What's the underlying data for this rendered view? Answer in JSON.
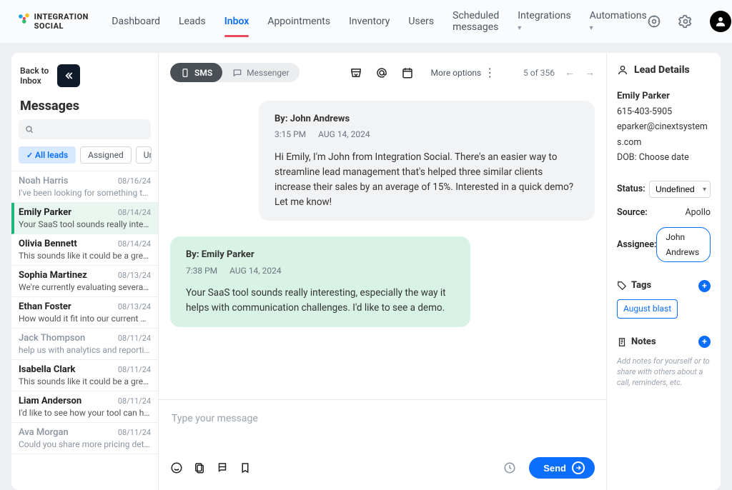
{
  "nav": {
    "brand": "INTEGRATION SOCIAL",
    "items": [
      "Dashboard",
      "Leads",
      "Inbox",
      "Appointments",
      "Inventory",
      "Users",
      "Scheduled messages",
      "Integrations",
      "Automations"
    ],
    "active_index": 2
  },
  "sidebar": {
    "back_label": "Back to Inbox",
    "title": "Messages",
    "filters": {
      "all": "All leads",
      "assigned": "Assigned",
      "unassigned": "Unassigned"
    },
    "leads": [
      {
        "name": "Noah Harris",
        "date": "08/16/24",
        "preview": "I've been looking for something th…",
        "dim": true,
        "selected": false
      },
      {
        "name": "Emily Parker",
        "date": "08/14/24",
        "preview": "Your SaaS tool sounds really inter…",
        "dim": false,
        "selected": true
      },
      {
        "name": "Olivia Bennett",
        "date": "08/14/24",
        "preview": "This sounds like it could be a great…",
        "dim": false,
        "selected": false
      },
      {
        "name": "Sophia Martinez",
        "date": "08/13/24",
        "preview": "We're currently evaluating several…",
        "dim": false,
        "selected": false
      },
      {
        "name": "Ethan Foster",
        "date": "08/13/24",
        "preview": "How would it fit into our current pr…",
        "dim": false,
        "selected": false
      },
      {
        "name": "Jack Thompson",
        "date": "08/11/24",
        "preview": "help us with analytics and reporti…",
        "dim": true,
        "selected": false
      },
      {
        "name": "Isabella Clark",
        "date": "08/11/24",
        "preview": "This sounds like it could be a great…",
        "dim": false,
        "selected": false
      },
      {
        "name": "Liam Anderson",
        "date": "08/11/24",
        "preview": "I'd like to see how your tool can he…",
        "dim": false,
        "selected": false
      },
      {
        "name": "Ava Morgan",
        "date": "08/11/24",
        "preview": "Could you share more pricing deta…",
        "dim": true,
        "selected": false
      }
    ]
  },
  "toolbar": {
    "sms_label": "SMS",
    "messenger_label": "Messenger",
    "more_options": "More options",
    "pager": "5 of 356"
  },
  "thread": {
    "msg1": {
      "by_prefix": "By: ",
      "by": "John Andrews",
      "time": "3:15 PM",
      "date": "AUG 14, 2024",
      "body": "Hi Emily, I'm John from Integration Social. There's an easier way to streamline lead management that's helped three similar clients increase their sales by an average of 15%. Interested in a quick demo? Let me know!"
    },
    "msg2": {
      "by_prefix": "By: ",
      "by": "Emily Parker",
      "time": "7:38 PM",
      "date": "AUG 14, 2024",
      "body": "Your SaaS tool sounds really interesting, especially the way it helps with communication challenges.  I'd like to see a demo."
    }
  },
  "composer": {
    "placeholder": "Type your message",
    "send_label": "Send"
  },
  "details": {
    "header": "Lead Details",
    "name": "Emily Parker",
    "phone": "615-403-5905",
    "email": "eparker@cinextsystems.com",
    "dob_label": "DOB: Choose date",
    "status_label": "Status:",
    "status_value": "Undefined",
    "source_label": "Source:",
    "source_value": "Apollo",
    "assignee_label": "Assignee:",
    "assignee_value": "John Andrews",
    "tags_header": "Tags",
    "tag": "August blast",
    "notes_header": "Notes",
    "notes_hint": "Add notes for yourself or to share with others about a call, reminders, etc."
  }
}
